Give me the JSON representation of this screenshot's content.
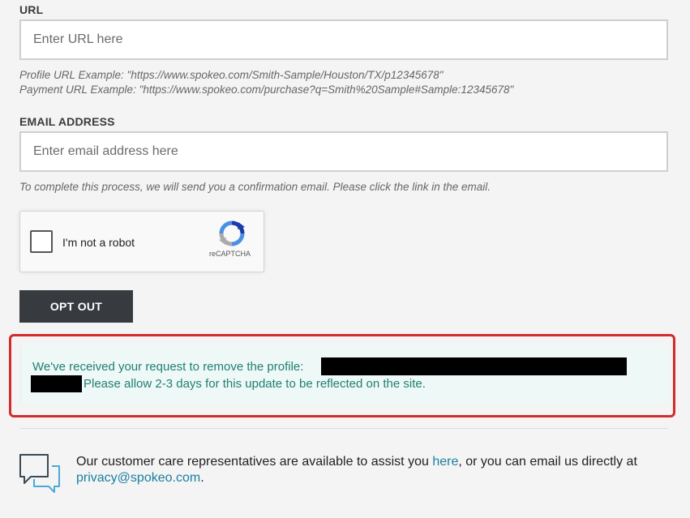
{
  "url_field": {
    "label": "URL",
    "placeholder": "Enter URL here",
    "value": ""
  },
  "url_hints": {
    "profile_example": "Profile URL Example: \"https://www.spokeo.com/Smith-Sample/Houston/TX/p12345678\"",
    "payment_example": "Payment URL Example: \"https://www.spokeo.com/purchase?q=Smith%20Sample#Sample:12345678\""
  },
  "email_field": {
    "label": "EMAIL ADDRESS",
    "placeholder": "Enter email address here",
    "value": "",
    "hint": "To complete this process, we will send you a confirmation email. Please click the link in the email."
  },
  "captcha": {
    "label": "I'm not a robot",
    "brand": "reCAPTCHA",
    "icon": "recaptcha-logo-icon",
    "checked": false
  },
  "opt_out_button": {
    "label": "OPT OUT"
  },
  "success_message": {
    "part1": "We've received your request to remove the profile: ",
    "part2": "Please allow 2-3 days for this update to be reflected on the site."
  },
  "support": {
    "icon": "chat-bubbles-icon",
    "text_before": "Our customer care representatives are available to assist you ",
    "link_here": "here",
    "text_middle": ", or you can email us directly at ",
    "email_link": "privacy@spokeo.com",
    "text_after": "."
  },
  "colors": {
    "background": "#f4f4f4",
    "button": "#373b40",
    "success_bg": "#eef8f6",
    "success_text": "#1f7f74",
    "link": "#1a7fa1",
    "highlight_border": "#d32b2b"
  }
}
